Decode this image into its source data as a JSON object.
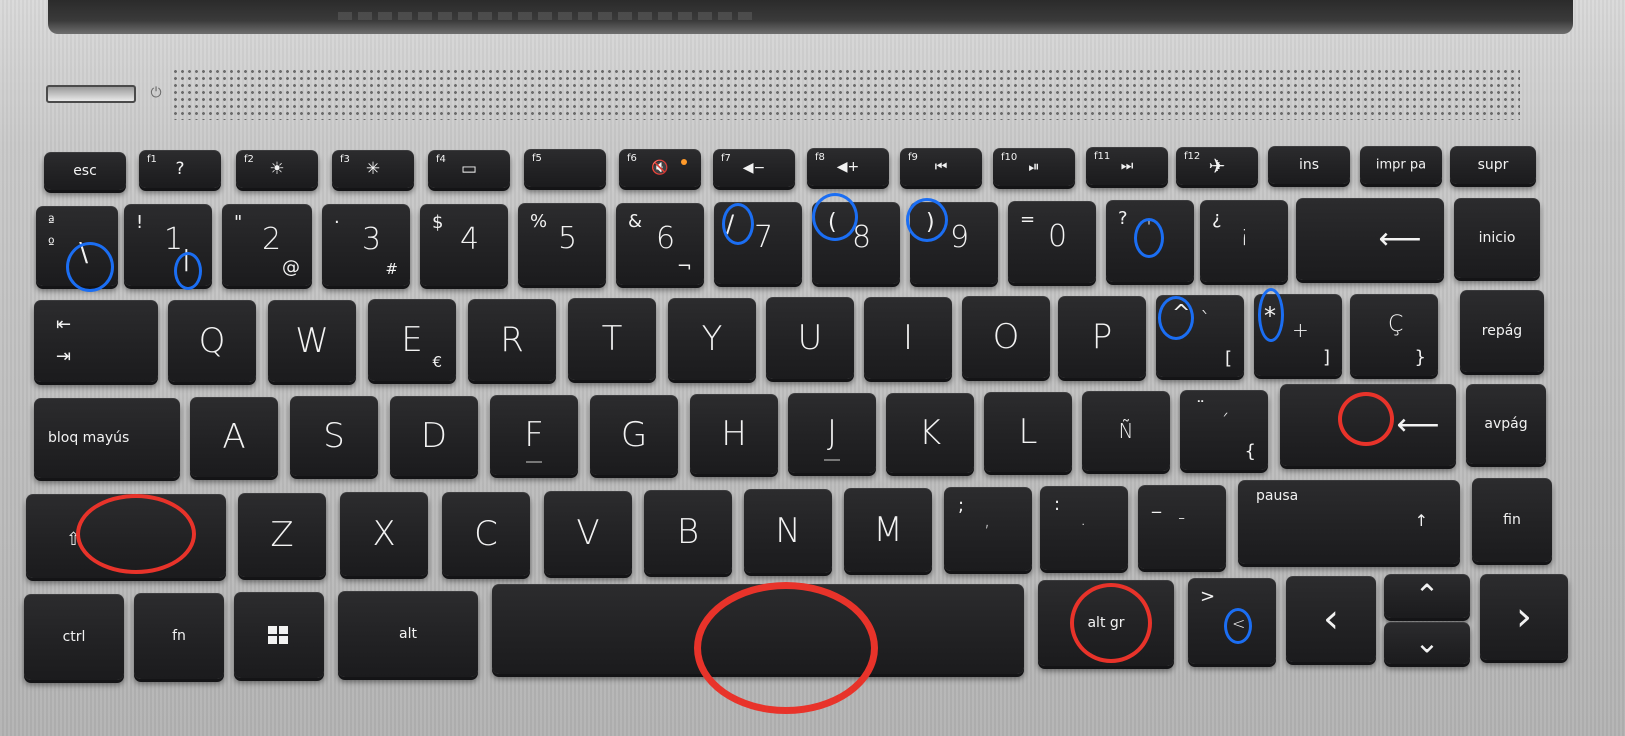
{
  "keyboard": {
    "function_row": {
      "esc": "esc",
      "f1": {
        "fn": "f1",
        "sym": "?"
      },
      "f2": {
        "fn": "f2",
        "sym": "☀"
      },
      "f3": {
        "fn": "f3",
        "sym": "✳"
      },
      "f4": {
        "fn": "f4",
        "sym": "▭"
      },
      "f5": {
        "fn": "f5",
        "sym": ""
      },
      "f6": {
        "fn": "f6",
        "sym": "🔇"
      },
      "f7": {
        "fn": "f7",
        "sym": "◀−"
      },
      "f8": {
        "fn": "f8",
        "sym": "◀+"
      },
      "f9": {
        "fn": "f9",
        "sym": "⏮"
      },
      "f10": {
        "fn": "f10",
        "sym": "⏯"
      },
      "f11": {
        "fn": "f11",
        "sym": "⏭"
      },
      "f12": {
        "fn": "f12",
        "sym": "✈"
      },
      "ins": "ins",
      "impr": "impr pa",
      "supr": "supr"
    },
    "number_row": {
      "k0": {
        "top": "ª",
        "mid": "º",
        "alt": "\\"
      },
      "k1": {
        "top": "!",
        "main": "1",
        "alt": "|"
      },
      "k2": {
        "top": "\"",
        "main": "2",
        "alt": "@"
      },
      "k3": {
        "top": "·",
        "main": "3",
        "alt": "#"
      },
      "k4": {
        "top": "$",
        "main": "4"
      },
      "k5": {
        "top": "%",
        "main": "5"
      },
      "k6": {
        "top": "&",
        "main": "6",
        "alt": "¬"
      },
      "k7": {
        "top": "/",
        "main": "7"
      },
      "k8": {
        "top": "(",
        "main": "8"
      },
      "k9": {
        "top": ")",
        "main": "9"
      },
      "k10": {
        "top": "=",
        "main": "0"
      },
      "k11": {
        "top": "?",
        "main": "'"
      },
      "k12": {
        "top": "¿",
        "main": "¡"
      },
      "backspace": "⟵",
      "inicio": "inicio"
    },
    "q_row": {
      "tab_top": "⇤",
      "tab_bottom": "⇥",
      "letters": [
        "Q",
        "W",
        "E",
        "R",
        "T",
        "Y",
        "U",
        "I",
        "O",
        "P"
      ],
      "e_alt": "€",
      "grave": {
        "top": "^",
        "main": "`",
        "alt": "["
      },
      "plus": {
        "top": "*",
        "main": "+",
        "alt": "]"
      },
      "cedilla": {
        "main": "Ç",
        "alt": "}"
      },
      "repag": "repág"
    },
    "a_row": {
      "caps": "bloq mayús",
      "letters": [
        "A",
        "S",
        "D",
        "F",
        "G",
        "H",
        "J",
        "K",
        "L",
        "Ñ"
      ],
      "acute": {
        "top": "¨",
        "main": "´",
        "alt": "{"
      },
      "enter": "⟵",
      "avpag": "avpág"
    },
    "z_row": {
      "shift": "⇧",
      "letters": [
        "Z",
        "X",
        "C",
        "V",
        "B",
        "N",
        "M"
      ],
      "comma": {
        "top": ";",
        "main": ","
      },
      "period": {
        "top": ":",
        "main": "."
      },
      "minus": {
        "top": "_",
        "main": "-"
      },
      "pausa": "pausa",
      "up": "↑",
      "fin": "fin"
    },
    "bottom_row": {
      "ctrl": "ctrl",
      "fn": "fn",
      "alt": "alt",
      "altgr": "alt gr",
      "angle": {
        "top": ">",
        "main": "<"
      },
      "left": "‹",
      "up": "⌃",
      "down": "⌄",
      "right": "›"
    }
  },
  "annotation_colors": {
    "blue": "#1b6ef3",
    "red": "#e8332a"
  },
  "icons": [
    "power-icon",
    "windows-icon",
    "backspace-arrow-icon",
    "enter-arrow-icon",
    "tab-icon",
    "airplane-icon",
    "mute-icon"
  ]
}
